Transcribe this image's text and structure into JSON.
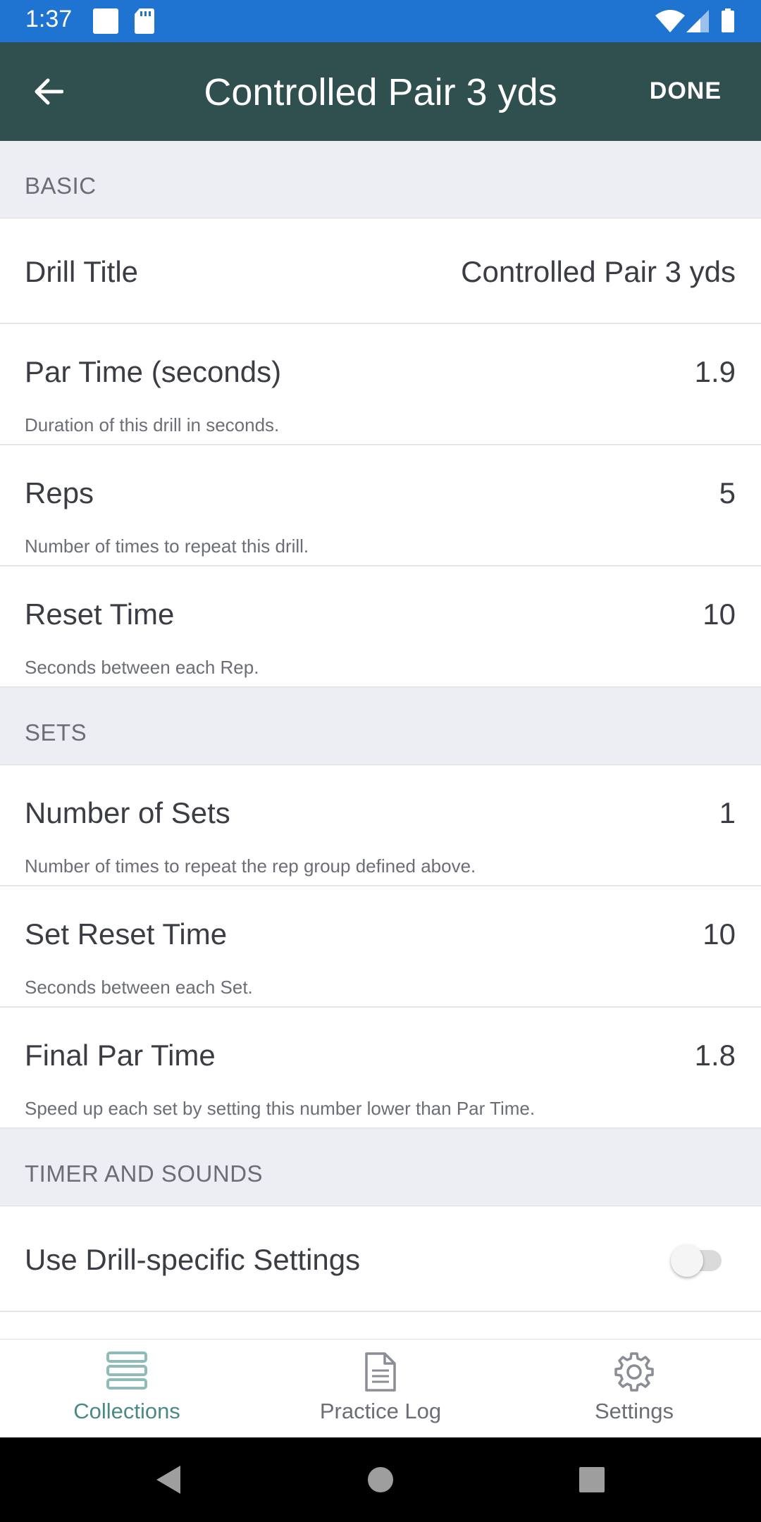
{
  "status_bar": {
    "time": "1:37"
  },
  "app_bar": {
    "title": "Controlled Pair 3 yds",
    "done_label": "DONE"
  },
  "sections": {
    "basic": {
      "header": "BASIC",
      "drill_title": {
        "label": "Drill Title",
        "value": "Controlled Pair 3 yds"
      },
      "par_time": {
        "label": "Par Time (seconds)",
        "value": "1.9",
        "desc": "Duration of this drill in seconds."
      },
      "reps": {
        "label": "Reps",
        "value": "5",
        "desc": "Number of times to repeat this drill."
      },
      "reset_time": {
        "label": "Reset Time",
        "value": "10",
        "desc": "Seconds between each Rep."
      }
    },
    "sets": {
      "header": "SETS",
      "number_of_sets": {
        "label": "Number of Sets",
        "value": "1",
        "desc": "Number of times to repeat the rep group defined above."
      },
      "set_reset_time": {
        "label": "Set Reset Time",
        "value": "10",
        "desc": "Seconds between each Set."
      },
      "final_par_time": {
        "label": "Final Par Time",
        "value": "1.8",
        "desc": "Speed up each set by setting this number lower than Par Time."
      }
    },
    "timer": {
      "header": "TIMER AND SOUNDS",
      "drill_specific": {
        "label": "Use Drill-specific Settings",
        "enabled": false
      }
    }
  },
  "bottom_nav": {
    "collections": "Collections",
    "practice_log": "Practice Log",
    "settings": "Settings",
    "active": "collections"
  },
  "colors": {
    "status_bar": "#1f74d2",
    "app_bar": "#30504f",
    "accent": "#4a8a86",
    "section_bg": "#eceef3"
  }
}
